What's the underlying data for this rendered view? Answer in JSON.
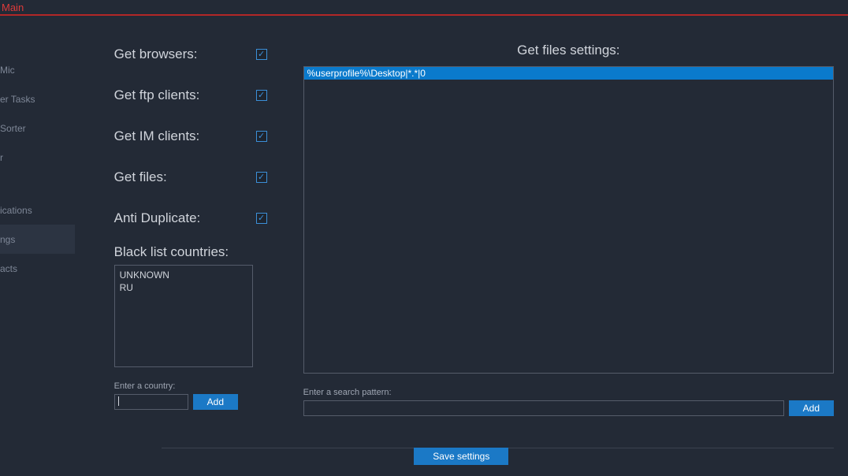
{
  "title": "Main",
  "sidebar": {
    "items": [
      {
        "label": "Mic"
      },
      {
        "label": "er Tasks"
      },
      {
        "label": "Sorter"
      },
      {
        "label": "r"
      },
      {
        "label": "ications"
      },
      {
        "label": "ngs"
      },
      {
        "label": "acts"
      }
    ],
    "activeIndex": 5,
    "spacerAfter": 3
  },
  "options": [
    {
      "label": "Get browsers:",
      "checked": true
    },
    {
      "label": "Get ftp clients:",
      "checked": true
    },
    {
      "label": "Get IM clients:",
      "checked": true
    },
    {
      "label": "Get files:",
      "checked": true
    },
    {
      "label": "Anti Duplicate:",
      "checked": true
    }
  ],
  "blacklist": {
    "label": "Black list countries:",
    "items": [
      "UNKNOWN",
      "RU"
    ],
    "input_label": "Enter a country:",
    "add_label": "Add"
  },
  "files": {
    "header": "Get files settings:",
    "items": [
      "%userprofile%\\Desktop|*.*|0"
    ],
    "selectedIndex": 0,
    "input_label": "Enter a search pattern:",
    "add_label": "Add"
  },
  "save_label": "Save settings"
}
